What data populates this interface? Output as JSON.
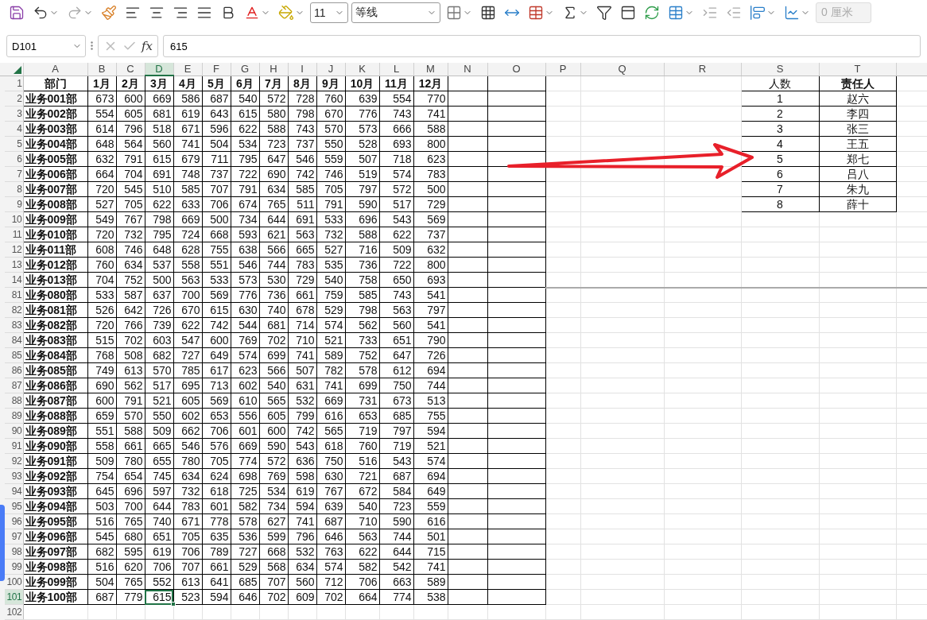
{
  "toolbar": {
    "font_size": "11",
    "font_name": "等线",
    "indent_value": "0 厘米",
    "indent_disabled": true
  },
  "formula_bar": {
    "name_box": "D101",
    "fx_label": "fx",
    "formula": "615"
  },
  "columns": [
    {
      "label": "A",
      "selected": false
    },
    {
      "label": "B",
      "selected": false
    },
    {
      "label": "C",
      "selected": false
    },
    {
      "label": "D",
      "selected": true
    },
    {
      "label": "E",
      "selected": false
    },
    {
      "label": "F",
      "selected": false
    },
    {
      "label": "G",
      "selected": false
    },
    {
      "label": "H",
      "selected": false
    },
    {
      "label": "I",
      "selected": false
    },
    {
      "label": "J",
      "selected": false
    },
    {
      "label": "K",
      "selected": false
    },
    {
      "label": "L",
      "selected": false
    },
    {
      "label": "M",
      "selected": false
    },
    {
      "label": "N",
      "selected": false
    },
    {
      "label": "O",
      "selected": false
    },
    {
      "label": "P",
      "selected": false
    },
    {
      "label": "Q",
      "selected": false
    },
    {
      "label": "R",
      "selected": false
    },
    {
      "label": "S",
      "selected": false
    },
    {
      "label": "T",
      "selected": false
    }
  ],
  "rows": [
    {
      "number": "1",
      "kind": "header",
      "selected": false,
      "cells": [
        "部门",
        "1月",
        "2月",
        "3月",
        "4月",
        "5月",
        "6月",
        "7月",
        "8月",
        "9月",
        "10月",
        "11月",
        "12月"
      ],
      "side": [
        {
          "text": "人数",
          "bold": false
        },
        {
          "text": "责任人",
          "bold": true
        }
      ]
    },
    {
      "number": "2",
      "kind": "data",
      "selected": false,
      "cells": [
        "业务001部",
        "673",
        "600",
        "669",
        "586",
        "687",
        "540",
        "572",
        "728",
        "760",
        "639",
        "554",
        "770"
      ],
      "side": [
        {
          "text": "1",
          "bold": false
        },
        {
          "text": "赵六",
          "bold": false
        }
      ]
    },
    {
      "number": "3",
      "kind": "data",
      "selected": false,
      "cells": [
        "业务002部",
        "554",
        "605",
        "681",
        "619",
        "643",
        "615",
        "580",
        "798",
        "670",
        "776",
        "743",
        "741"
      ],
      "side": [
        {
          "text": "2",
          "bold": false
        },
        {
          "text": "李四",
          "bold": false
        }
      ]
    },
    {
      "number": "4",
      "kind": "data",
      "selected": false,
      "cells": [
        "业务003部",
        "614",
        "796",
        "518",
        "671",
        "596",
        "622",
        "588",
        "743",
        "570",
        "573",
        "666",
        "588"
      ],
      "side": [
        {
          "text": "3",
          "bold": false
        },
        {
          "text": "张三",
          "bold": false
        }
      ]
    },
    {
      "number": "5",
      "kind": "data",
      "selected": false,
      "cells": [
        "业务004部",
        "648",
        "564",
        "560",
        "741",
        "504",
        "534",
        "723",
        "737",
        "550",
        "528",
        "693",
        "800"
      ],
      "side": [
        {
          "text": "4",
          "bold": false
        },
        {
          "text": "王五",
          "bold": false
        }
      ]
    },
    {
      "number": "6",
      "kind": "data",
      "selected": false,
      "cells": [
        "业务005部",
        "632",
        "791",
        "615",
        "679",
        "711",
        "795",
        "647",
        "546",
        "559",
        "507",
        "718",
        "623"
      ],
      "side": [
        {
          "text": "5",
          "bold": false
        },
        {
          "text": "郑七",
          "bold": false
        }
      ]
    },
    {
      "number": "7",
      "kind": "data",
      "selected": false,
      "cells": [
        "业务006部",
        "664",
        "704",
        "691",
        "748",
        "737",
        "722",
        "690",
        "742",
        "746",
        "519",
        "574",
        "783"
      ],
      "side": [
        {
          "text": "6",
          "bold": false
        },
        {
          "text": "吕八",
          "bold": false
        }
      ]
    },
    {
      "number": "8",
      "kind": "data",
      "selected": false,
      "cells": [
        "业务007部",
        "720",
        "545",
        "510",
        "585",
        "707",
        "791",
        "634",
        "585",
        "705",
        "797",
        "572",
        "500"
      ],
      "side": [
        {
          "text": "7",
          "bold": false
        },
        {
          "text": "朱九",
          "bold": false
        }
      ]
    },
    {
      "number": "9",
      "kind": "data",
      "selected": false,
      "cells": [
        "业务008部",
        "527",
        "705",
        "622",
        "633",
        "706",
        "674",
        "765",
        "511",
        "791",
        "590",
        "517",
        "729"
      ],
      "side": [
        {
          "text": "8",
          "bold": false
        },
        {
          "text": "薛十",
          "bold": false
        }
      ]
    },
    {
      "number": "10",
      "kind": "data",
      "selected": false,
      "cells": [
        "业务009部",
        "549",
        "767",
        "798",
        "669",
        "500",
        "734",
        "644",
        "691",
        "533",
        "696",
        "543",
        "569"
      ]
    },
    {
      "number": "11",
      "kind": "data",
      "selected": false,
      "cells": [
        "业务010部",
        "720",
        "732",
        "795",
        "724",
        "668",
        "593",
        "621",
        "563",
        "732",
        "588",
        "622",
        "737"
      ]
    },
    {
      "number": "12",
      "kind": "data",
      "selected": false,
      "cells": [
        "业务011部",
        "608",
        "746",
        "648",
        "628",
        "755",
        "638",
        "566",
        "665",
        "527",
        "716",
        "509",
        "632"
      ]
    },
    {
      "number": "13",
      "kind": "data",
      "selected": false,
      "cells": [
        "业务012部",
        "760",
        "634",
        "537",
        "558",
        "551",
        "546",
        "744",
        "783",
        "535",
        "736",
        "722",
        "800"
      ]
    },
    {
      "number": "14",
      "kind": "data",
      "selected": false,
      "split_below": true,
      "cells": [
        "业务013部",
        "704",
        "752",
        "500",
        "563",
        "533",
        "573",
        "530",
        "729",
        "540",
        "758",
        "650",
        "693"
      ]
    },
    {
      "number": "81",
      "kind": "data",
      "selected": false,
      "cells": [
        "业务080部",
        "533",
        "587",
        "637",
        "700",
        "569",
        "776",
        "736",
        "661",
        "759",
        "585",
        "743",
        "541"
      ]
    },
    {
      "number": "82",
      "kind": "data",
      "selected": false,
      "cells": [
        "业务081部",
        "526",
        "642",
        "726",
        "670",
        "615",
        "630",
        "740",
        "678",
        "529",
        "798",
        "563",
        "797"
      ]
    },
    {
      "number": "83",
      "kind": "data",
      "selected": false,
      "cells": [
        "业务082部",
        "720",
        "766",
        "739",
        "622",
        "742",
        "544",
        "681",
        "714",
        "574",
        "562",
        "560",
        "541"
      ]
    },
    {
      "number": "84",
      "kind": "data",
      "selected": false,
      "cells": [
        "业务083部",
        "515",
        "702",
        "603",
        "547",
        "600",
        "769",
        "702",
        "710",
        "521",
        "733",
        "651",
        "790"
      ]
    },
    {
      "number": "85",
      "kind": "data",
      "selected": false,
      "cells": [
        "业务084部",
        "768",
        "508",
        "682",
        "727",
        "649",
        "574",
        "699",
        "741",
        "589",
        "752",
        "647",
        "726"
      ]
    },
    {
      "number": "86",
      "kind": "data",
      "selected": false,
      "cells": [
        "业务085部",
        "749",
        "613",
        "570",
        "785",
        "617",
        "623",
        "566",
        "507",
        "782",
        "578",
        "612",
        "694"
      ]
    },
    {
      "number": "87",
      "kind": "data",
      "selected": false,
      "cells": [
        "业务086部",
        "690",
        "562",
        "517",
        "695",
        "713",
        "602",
        "540",
        "631",
        "741",
        "699",
        "750",
        "744"
      ]
    },
    {
      "number": "88",
      "kind": "data",
      "selected": false,
      "cells": [
        "业务087部",
        "600",
        "791",
        "521",
        "605",
        "569",
        "610",
        "565",
        "532",
        "669",
        "731",
        "673",
        "513"
      ]
    },
    {
      "number": "89",
      "kind": "data",
      "selected": false,
      "cells": [
        "业务088部",
        "659",
        "570",
        "550",
        "602",
        "653",
        "556",
        "605",
        "799",
        "616",
        "653",
        "685",
        "755"
      ]
    },
    {
      "number": "90",
      "kind": "data",
      "selected": false,
      "cells": [
        "业务089部",
        "551",
        "588",
        "509",
        "662",
        "706",
        "601",
        "600",
        "742",
        "565",
        "719",
        "797",
        "594"
      ]
    },
    {
      "number": "91",
      "kind": "data",
      "selected": false,
      "cells": [
        "业务090部",
        "558",
        "661",
        "665",
        "546",
        "576",
        "669",
        "590",
        "543",
        "618",
        "760",
        "719",
        "521"
      ]
    },
    {
      "number": "92",
      "kind": "data",
      "selected": false,
      "cells": [
        "业务091部",
        "509",
        "780",
        "655",
        "780",
        "705",
        "774",
        "572",
        "636",
        "750",
        "516",
        "543",
        "574"
      ]
    },
    {
      "number": "93",
      "kind": "data",
      "selected": false,
      "cells": [
        "业务092部",
        "754",
        "654",
        "745",
        "634",
        "624",
        "698",
        "769",
        "598",
        "630",
        "721",
        "687",
        "694"
      ]
    },
    {
      "number": "94",
      "kind": "data",
      "selected": false,
      "cells": [
        "业务093部",
        "645",
        "696",
        "597",
        "732",
        "618",
        "725",
        "534",
        "619",
        "767",
        "672",
        "584",
        "649"
      ]
    },
    {
      "number": "95",
      "kind": "data",
      "selected": false,
      "cells": [
        "业务094部",
        "503",
        "700",
        "644",
        "783",
        "601",
        "582",
        "734",
        "594",
        "639",
        "540",
        "723",
        "559"
      ]
    },
    {
      "number": "96",
      "kind": "data",
      "selected": false,
      "cells": [
        "业务095部",
        "516",
        "765",
        "740",
        "671",
        "778",
        "578",
        "627",
        "741",
        "687",
        "710",
        "590",
        "616"
      ]
    },
    {
      "number": "97",
      "kind": "data",
      "selected": false,
      "cells": [
        "业务096部",
        "545",
        "680",
        "651",
        "705",
        "635",
        "536",
        "599",
        "796",
        "646",
        "563",
        "744",
        "501"
      ]
    },
    {
      "number": "98",
      "kind": "data",
      "selected": false,
      "cells": [
        "业务097部",
        "682",
        "595",
        "619",
        "706",
        "789",
        "727",
        "668",
        "532",
        "763",
        "622",
        "644",
        "715"
      ]
    },
    {
      "number": "99",
      "kind": "data",
      "selected": false,
      "cells": [
        "业务098部",
        "516",
        "620",
        "706",
        "707",
        "661",
        "529",
        "568",
        "634",
        "574",
        "582",
        "542",
        "741"
      ]
    },
    {
      "number": "100",
      "kind": "data",
      "selected": false,
      "cells": [
        "业务099部",
        "504",
        "765",
        "552",
        "613",
        "641",
        "685",
        "707",
        "560",
        "712",
        "706",
        "663",
        "589"
      ]
    },
    {
      "number": "101",
      "kind": "data",
      "selected": true,
      "cells": [
        "业务100部",
        "687",
        "779",
        "615",
        "523",
        "594",
        "646",
        "702",
        "609",
        "702",
        "664",
        "774",
        "538"
      ]
    },
    {
      "number": "102",
      "kind": "empty",
      "selected": false
    }
  ]
}
